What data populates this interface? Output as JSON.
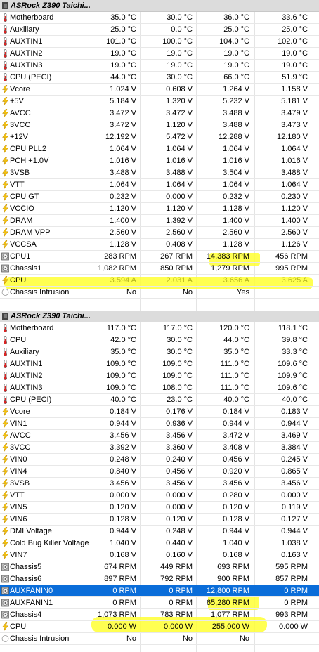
{
  "sections": [
    {
      "title": "ASRock Z390 Taichi...",
      "rows": [
        {
          "name": "Motherboard",
          "v": [
            "35.0 °C",
            "30.0 °C",
            "36.0 °C",
            "33.6 °C"
          ],
          "icon": "thermometer"
        },
        {
          "name": "Auxiliary",
          "v": [
            "25.0 °C",
            "0.0 °C",
            "25.0 °C",
            "25.0 °C"
          ],
          "icon": "thermometer"
        },
        {
          "name": "AUXTIN1",
          "v": [
            "101.0 °C",
            "100.0 °C",
            "104.0 °C",
            "102.0 °C"
          ],
          "icon": "thermometer"
        },
        {
          "name": "AUXTIN2",
          "v": [
            "19.0 °C",
            "19.0 °C",
            "19.0 °C",
            "19.0 °C"
          ],
          "icon": "thermometer"
        },
        {
          "name": "AUXTIN3",
          "v": [
            "19.0 °C",
            "19.0 °C",
            "19.0 °C",
            "19.0 °C"
          ],
          "icon": "thermometer"
        },
        {
          "name": "CPU (PECI)",
          "v": [
            "44.0 °C",
            "30.0 °C",
            "66.0 °C",
            "51.9 °C"
          ],
          "icon": "thermometer"
        },
        {
          "name": "Vcore",
          "v": [
            "1.024 V",
            "0.608 V",
            "1.264 V",
            "1.158 V"
          ],
          "icon": "bolt"
        },
        {
          "name": "+5V",
          "v": [
            "5.184 V",
            "1.320 V",
            "5.232 V",
            "5.181 V"
          ],
          "icon": "bolt"
        },
        {
          "name": "AVCC",
          "v": [
            "3.472 V",
            "3.472 V",
            "3.488 V",
            "3.479 V"
          ],
          "icon": "bolt"
        },
        {
          "name": "3VCC",
          "v": [
            "3.472 V",
            "1.120 V",
            "3.488 V",
            "3.473 V"
          ],
          "icon": "bolt"
        },
        {
          "name": "+12V",
          "v": [
            "12.192 V",
            "5.472 V",
            "12.288 V",
            "12.180 V"
          ],
          "icon": "bolt"
        },
        {
          "name": "CPU PLL2",
          "v": [
            "1.064 V",
            "1.064 V",
            "1.064 V",
            "1.064 V"
          ],
          "icon": "bolt"
        },
        {
          "name": "PCH +1.0V",
          "v": [
            "1.016 V",
            "1.016 V",
            "1.016 V",
            "1.016 V"
          ],
          "icon": "bolt"
        },
        {
          "name": "3VSB",
          "v": [
            "3.488 V",
            "3.488 V",
            "3.504 V",
            "3.488 V"
          ],
          "icon": "bolt"
        },
        {
          "name": "VTT",
          "v": [
            "1.064 V",
            "1.064 V",
            "1.064 V",
            "1.064 V"
          ],
          "icon": "bolt"
        },
        {
          "name": "CPU GT",
          "v": [
            "0.232 V",
            "0.000 V",
            "0.232 V",
            "0.230 V"
          ],
          "icon": "bolt"
        },
        {
          "name": "VCCIO",
          "v": [
            "1.120 V",
            "1.120 V",
            "1.128 V",
            "1.120 V"
          ],
          "icon": "bolt"
        },
        {
          "name": "DRAM",
          "v": [
            "1.400 V",
            "1.392 V",
            "1.400 V",
            "1.400 V"
          ],
          "icon": "bolt"
        },
        {
          "name": "DRAM VPP",
          "v": [
            "2.560 V",
            "2.560 V",
            "2.560 V",
            "2.560 V"
          ],
          "icon": "bolt"
        },
        {
          "name": "VCCSA",
          "v": [
            "1.128 V",
            "0.408 V",
            "1.128 V",
            "1.126 V"
          ],
          "icon": "bolt"
        },
        {
          "name": "CPU1",
          "v": [
            "283 RPM",
            "267 RPM",
            "14,383 RPM",
            "456 RPM"
          ],
          "icon": "fan"
        },
        {
          "name": "Chassis1",
          "v": [
            "1,082 RPM",
            "850 RPM",
            "1,279 RPM",
            "995 RPM"
          ],
          "icon": "fan"
        },
        {
          "name": "CPU",
          "v": [
            "3.594 A",
            "2.031 A",
            "3.656 A",
            "3.625 A"
          ],
          "icon": "bolt",
          "dim": true
        },
        {
          "name": "Chassis Intrusion",
          "v": [
            "No",
            "No",
            "Yes",
            ""
          ],
          "icon": "check"
        }
      ]
    },
    {
      "title": "ASRock Z390 Taichi...",
      "rows": [
        {
          "name": "Motherboard",
          "v": [
            "117.0 °C",
            "117.0 °C",
            "120.0 °C",
            "118.1 °C"
          ],
          "icon": "thermometer"
        },
        {
          "name": "CPU",
          "v": [
            "42.0 °C",
            "30.0 °C",
            "44.0 °C",
            "39.8 °C"
          ],
          "icon": "thermometer"
        },
        {
          "name": "Auxiliary",
          "v": [
            "35.0 °C",
            "30.0 °C",
            "35.0 °C",
            "33.3 °C"
          ],
          "icon": "thermometer"
        },
        {
          "name": "AUXTIN1",
          "v": [
            "109.0 °C",
            "109.0 °C",
            "111.0 °C",
            "109.6 °C"
          ],
          "icon": "thermometer"
        },
        {
          "name": "AUXTIN2",
          "v": [
            "109.0 °C",
            "109.0 °C",
            "111.0 °C",
            "109.9 °C"
          ],
          "icon": "thermometer"
        },
        {
          "name": "AUXTIN3",
          "v": [
            "109.0 °C",
            "108.0 °C",
            "111.0 °C",
            "109.6 °C"
          ],
          "icon": "thermometer"
        },
        {
          "name": "CPU (PECI)",
          "v": [
            "40.0 °C",
            "23.0 °C",
            "40.0 °C",
            "40.0 °C"
          ],
          "icon": "thermometer"
        },
        {
          "name": "Vcore",
          "v": [
            "0.184 V",
            "0.176 V",
            "0.184 V",
            "0.183 V"
          ],
          "icon": "bolt"
        },
        {
          "name": "VIN1",
          "v": [
            "0.944 V",
            "0.936 V",
            "0.944 V",
            "0.944 V"
          ],
          "icon": "bolt"
        },
        {
          "name": "AVCC",
          "v": [
            "3.456 V",
            "3.456 V",
            "3.472 V",
            "3.469 V"
          ],
          "icon": "bolt"
        },
        {
          "name": "3VCC",
          "v": [
            "3.392 V",
            "3.360 V",
            "3.408 V",
            "3.384 V"
          ],
          "icon": "bolt"
        },
        {
          "name": "VIN0",
          "v": [
            "0.248 V",
            "0.240 V",
            "0.456 V",
            "0.245 V"
          ],
          "icon": "bolt"
        },
        {
          "name": "VIN4",
          "v": [
            "0.840 V",
            "0.456 V",
            "0.920 V",
            "0.865 V"
          ],
          "icon": "bolt"
        },
        {
          "name": "3VSB",
          "v": [
            "3.456 V",
            "3.456 V",
            "3.456 V",
            "3.456 V"
          ],
          "icon": "bolt"
        },
        {
          "name": "VTT",
          "v": [
            "0.000 V",
            "0.000 V",
            "0.280 V",
            "0.000 V"
          ],
          "icon": "bolt"
        },
        {
          "name": "VIN5",
          "v": [
            "0.120 V",
            "0.000 V",
            "0.120 V",
            "0.119 V"
          ],
          "icon": "bolt"
        },
        {
          "name": "VIN6",
          "v": [
            "0.128 V",
            "0.120 V",
            "0.128 V",
            "0.127 V"
          ],
          "icon": "bolt"
        },
        {
          "name": "DMI Voltage",
          "v": [
            "0.944 V",
            "0.248 V",
            "0.944 V",
            "0.944 V"
          ],
          "icon": "bolt"
        },
        {
          "name": "Cold Bug Killer Voltage",
          "v": [
            "1.040 V",
            "0.440 V",
            "1.040 V",
            "1.038 V"
          ],
          "icon": "bolt"
        },
        {
          "name": "VIN7",
          "v": [
            "0.168 V",
            "0.160 V",
            "0.168 V",
            "0.163 V"
          ],
          "icon": "bolt"
        },
        {
          "name": "Chassis5",
          "v": [
            "674 RPM",
            "449 RPM",
            "693 RPM",
            "595 RPM"
          ],
          "icon": "fan"
        },
        {
          "name": "Chassis6",
          "v": [
            "897 RPM",
            "792 RPM",
            "900 RPM",
            "857 RPM"
          ],
          "icon": "fan"
        },
        {
          "name": "AUXFANIN0",
          "v": [
            "0 RPM",
            "0 RPM",
            "12,800 RPM",
            "0 RPM"
          ],
          "icon": "fan",
          "selected": true
        },
        {
          "name": "AUXFANIN1",
          "v": [
            "0 RPM",
            "0 RPM",
            "65,280 RPM",
            "0 RPM"
          ],
          "icon": "fan"
        },
        {
          "name": "Chassis4",
          "v": [
            "1,073 RPM",
            "783 RPM",
            "1,077 RPM",
            "993 RPM"
          ],
          "icon": "fan"
        },
        {
          "name": "CPU",
          "v": [
            "0.000 W",
            "0.000 W",
            "255.000 W",
            "0.000 W"
          ],
          "icon": "bolt"
        },
        {
          "name": "Chassis Intrusion",
          "v": [
            "No",
            "No",
            "No",
            ""
          ],
          "icon": "check"
        }
      ]
    }
  ],
  "colors": {
    "selected": "#0a6dd9",
    "highlight": "#ffff33",
    "dim_text": "#b8b820"
  }
}
